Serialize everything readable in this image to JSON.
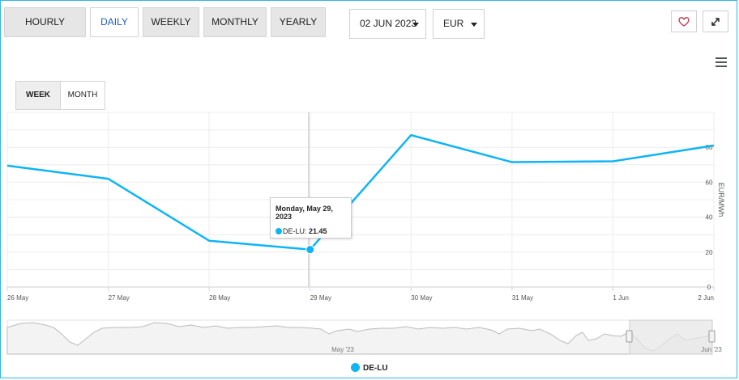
{
  "period_tabs": [
    "HOURLY",
    "DAILY",
    "WEEKLY",
    "MONTHLY",
    "YEARLY"
  ],
  "active_period": "DAILY",
  "date_select": {
    "value": "02 JUN 2023"
  },
  "currency_select": {
    "value": "EUR"
  },
  "icons": {
    "favorite": "heart-icon",
    "expand": "expand-icon",
    "menu": "hamburger-menu-icon"
  },
  "range_tabs": {
    "week": "WEEK",
    "month": "MONTH",
    "active": "WEEK"
  },
  "tooltip": {
    "title": "Monday, May 29, 2023",
    "series": "DE-LU: ",
    "value": "21.45"
  },
  "navigator": {
    "labels": [
      "May '23",
      "Jun '23"
    ]
  },
  "legend": {
    "label": "DE-LU"
  },
  "colors": {
    "series": "#0fb4f5",
    "accent_border": "#2fb6e6",
    "active_tab_text": "#1e5fb4"
  },
  "chart_data": {
    "type": "line",
    "x": [
      "26 May",
      "27 May",
      "28 May",
      "29 May",
      "30 May",
      "31 May",
      "1 Jun",
      "2 Jun"
    ],
    "series": [
      {
        "name": "DE-LU",
        "values": [
          69.5,
          62.0,
          26.5,
          21.45,
          87.0,
          71.5,
          72.0,
          81.0
        ]
      }
    ],
    "ylabel": "EUR/MWh",
    "yticks": [
      0,
      20,
      40,
      60,
      80
    ],
    "ylim": [
      0,
      100
    ],
    "highlight_index": 3,
    "grid": true,
    "y_axis_side": "right",
    "legend_position": "bottom-center"
  }
}
